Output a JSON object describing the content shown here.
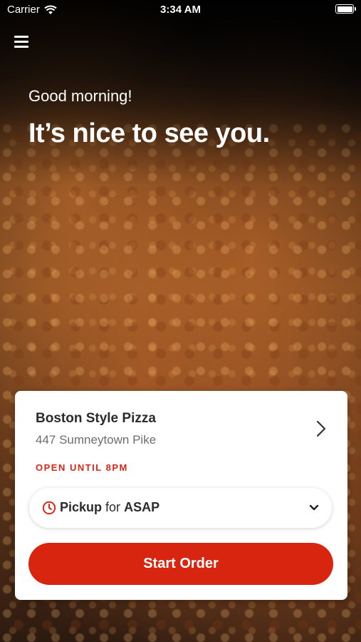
{
  "status_bar": {
    "carrier": "Carrier",
    "time": "3:34 AM",
    "wifi_icon": "wifi-icon",
    "battery_icon": "battery-icon"
  },
  "header": {
    "menu_icon": "hamburger-menu-icon",
    "greeting": "Good morning!",
    "headline": "It’s nice to see you."
  },
  "store": {
    "name": "Boston Style Pizza",
    "address": "447 Sumneytown Pike",
    "hours": "OPEN UNTIL 8PM",
    "chevron_icon": "chevron-right-icon"
  },
  "order_mode": {
    "icon": "clock-icon",
    "mode": "Pickup",
    "connector": "for",
    "time": "ASAP",
    "dropdown_icon": "chevron-down-icon"
  },
  "actions": {
    "start_order": "Start Order"
  },
  "colors": {
    "accent": "#d8250f",
    "hours_text": "#d8261a",
    "card_background": "#ffffff",
    "text_primary": "#2b2b2b",
    "text_secondary": "#6d6d6d"
  }
}
